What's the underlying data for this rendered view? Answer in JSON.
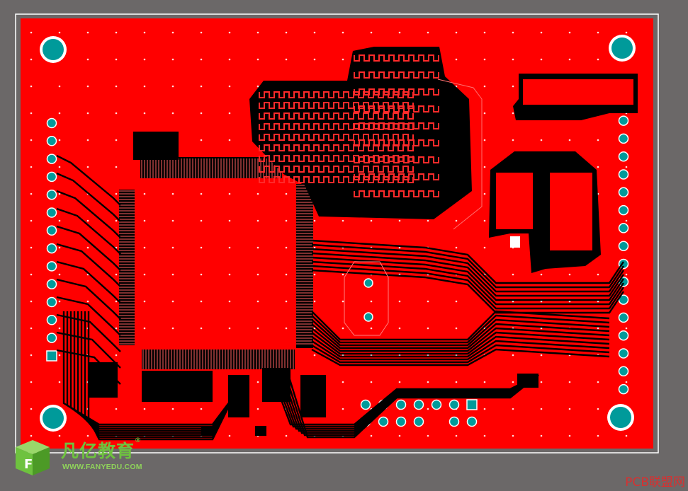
{
  "brand": {
    "name_cn": "凡亿教育",
    "reg_mark": "®",
    "url": "WWW.FANYEDU.COM",
    "color": "#6ec23f"
  },
  "watermark": "PCB联盟网",
  "board": {
    "copper_color": "#ff0000",
    "background_color": "#6b6868",
    "outline_color": "#ffffff",
    "pad_color": "#009a9a",
    "trace_color": "#000000"
  }
}
